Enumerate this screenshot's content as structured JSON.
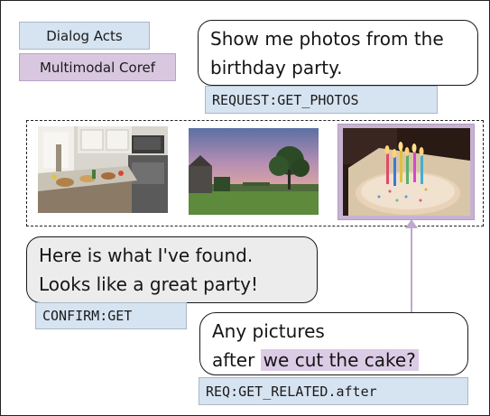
{
  "legend": {
    "dialog_acts": "Dialog Acts",
    "multimodal_coref": "Multimodal Coref"
  },
  "turns": {
    "user1": {
      "line1": "Show me photos from the",
      "line2": "birthday party.",
      "act": "REQUEST:GET_PHOTOS"
    },
    "system": {
      "line1": "Here is what I've found.",
      "line2": "Looks like a great party!",
      "act": "CONFIRM:GET"
    },
    "user2": {
      "line1": "Any pictures",
      "line2_prefix": "after ",
      "line2_coref": "we cut the cake?",
      "act": "REQ:GET_RELATED.after"
    }
  },
  "photos": [
    {
      "name": "kitchen-party-photo"
    },
    {
      "name": "sunset-landscape-photo"
    },
    {
      "name": "birthday-cake-photo"
    }
  ],
  "colors": {
    "dialog_act_fill": "#d6e3f1",
    "coref_fill": "#d9c7e0",
    "coref_arrow": "#bfa7cf",
    "system_bubble": "#ececec"
  }
}
